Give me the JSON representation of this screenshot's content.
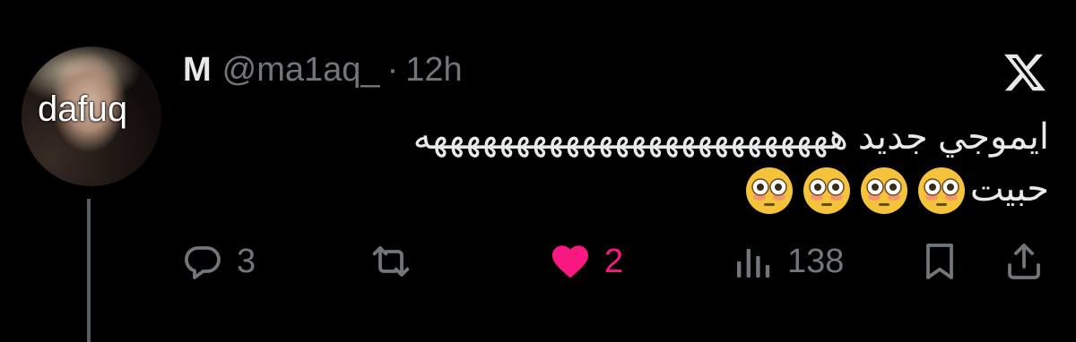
{
  "tweet": {
    "author_name": "M",
    "handle": "@ma1aq_",
    "separator": "·",
    "time": "12h",
    "avatar_text": "dafuq",
    "text_line1": "ايموجي جديد هههههههههههههههههههههههههه",
    "text_line2": "حبيت",
    "emojis": [
      "flushed-face",
      "flushed-face",
      "flushed-face",
      "flushed-face"
    ]
  },
  "actions": {
    "replies": "3",
    "retweets": "",
    "likes": "2",
    "views": "138"
  },
  "colors": {
    "background": "#000000",
    "text": "#e7e9ea",
    "muted": "#71767b",
    "like": "#f91880",
    "thread_line": "#555c62"
  }
}
